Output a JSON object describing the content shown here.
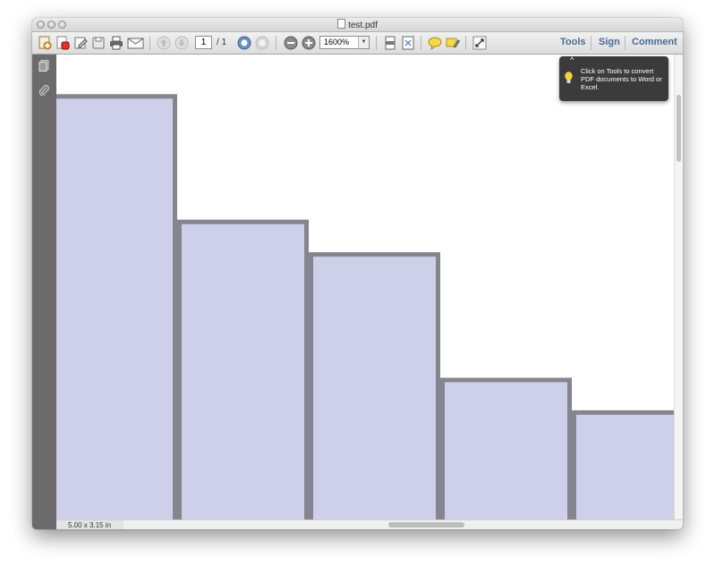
{
  "window": {
    "title": "test.pdf"
  },
  "toolbar": {
    "page_current": "1",
    "page_total": "/ 1",
    "zoom_value": "1600%",
    "tools_label": "Tools",
    "sign_label": "Sign",
    "comment_label": "Comment",
    "icons": [
      "create-pdf-icon",
      "open-icon",
      "edit-icon",
      "save-icon",
      "print-icon",
      "email-icon",
      "previous-page-icon",
      "next-page-icon",
      "first-page-icon",
      "last-page-icon",
      "zoom-out-icon",
      "zoom-in-icon",
      "scroll-mode-icon",
      "fit-page-icon",
      "comment-icon",
      "highlight-icon",
      "fullscreen-icon"
    ]
  },
  "sidebar": {
    "icons": [
      "pages-icon",
      "attachments-icon"
    ]
  },
  "tooltip": {
    "text": "Click on Tools to convert PDF documents to Word or Excel."
  },
  "status": {
    "page_size": "5.00 x 3.15 in"
  },
  "colors": {
    "bar_fill": "#cdd0e8",
    "bar_edge": "#84858f",
    "link_blue": "#4a6a95"
  },
  "chart_data": {
    "type": "bar",
    "title": "",
    "xlabel": "",
    "ylabel": "",
    "note": "zoomed view of bar chart; only bar tops visible",
    "visible_bar_tops_from_top_of_view": [
      0.91,
      0.64,
      0.57,
      0.3,
      0.23
    ]
  }
}
